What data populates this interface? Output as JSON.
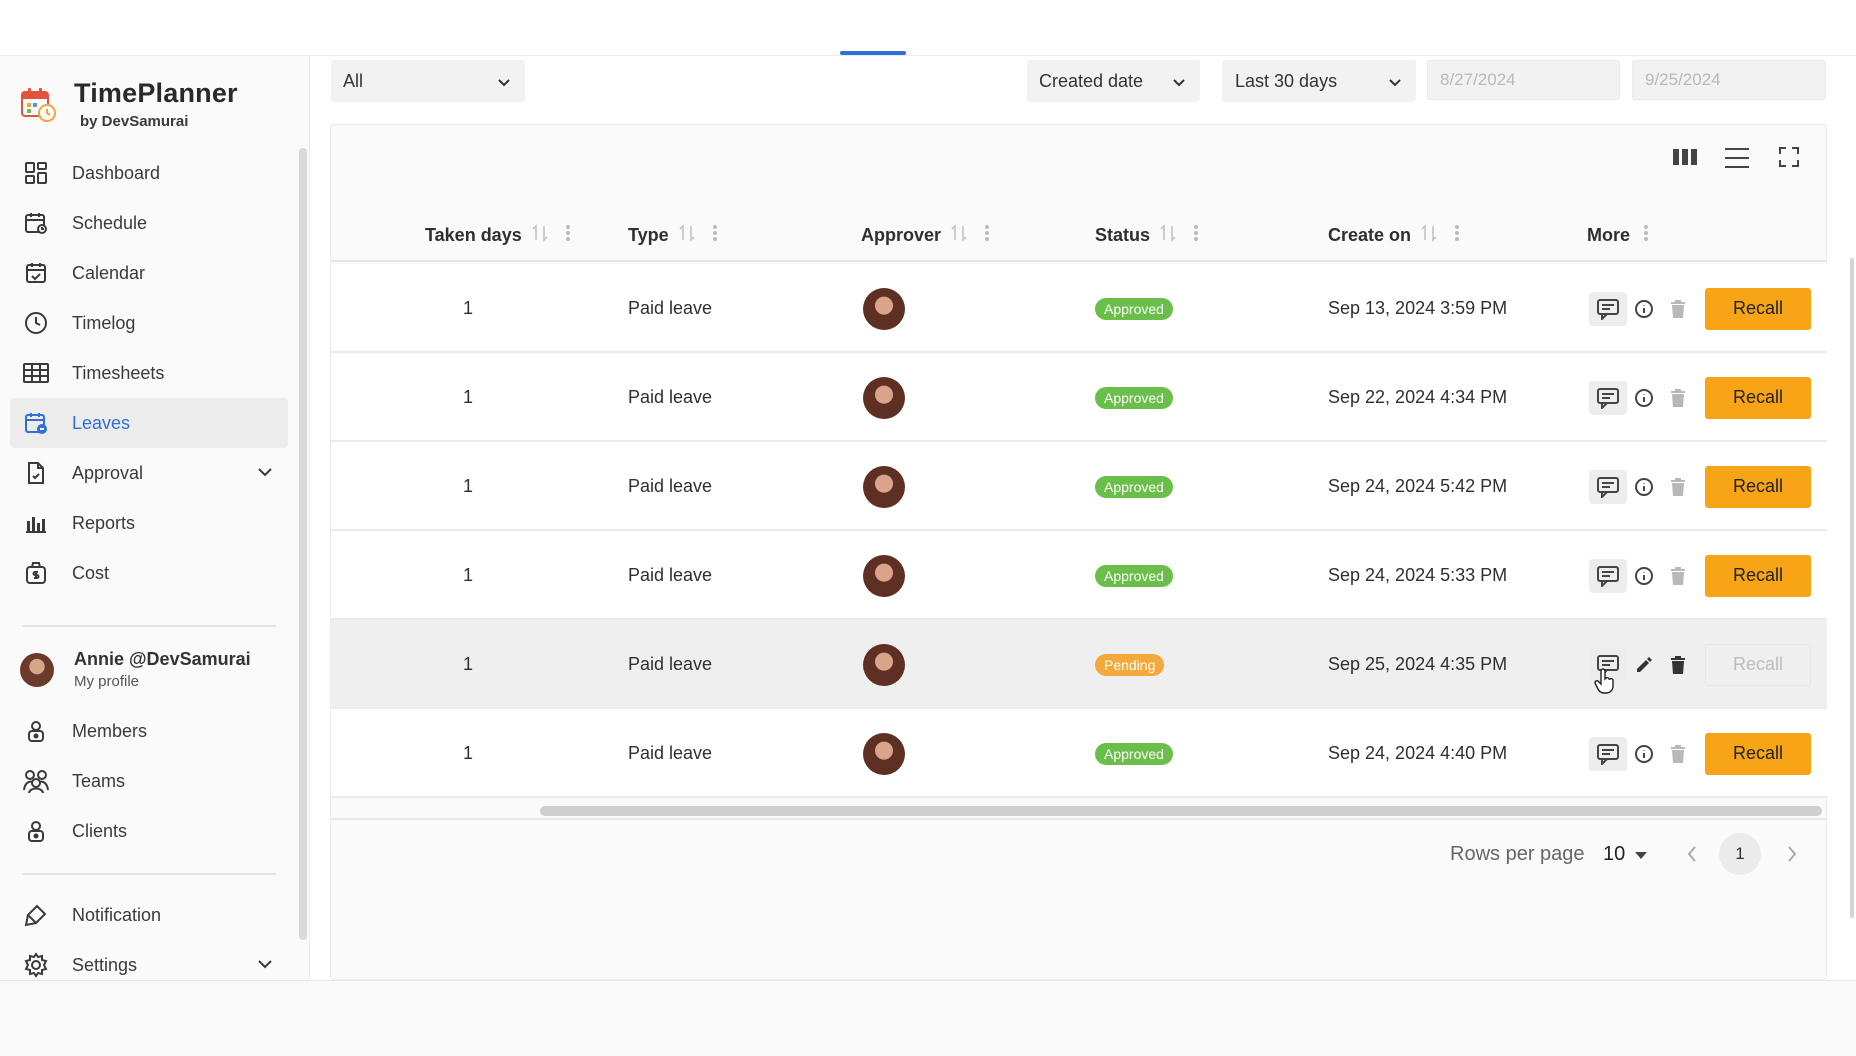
{
  "brand": {
    "name": "TimePlanner",
    "by": "by DevSamurai"
  },
  "sidebar": {
    "items": [
      {
        "label": "Dashboard",
        "icon": "dashboard-icon"
      },
      {
        "label": "Schedule",
        "icon": "schedule-icon"
      },
      {
        "label": "Calendar",
        "icon": "calendar-icon"
      },
      {
        "label": "Timelog",
        "icon": "clock-icon"
      },
      {
        "label": "Timesheets",
        "icon": "table-icon"
      },
      {
        "label": "Leaves",
        "icon": "leaves-icon",
        "active": true
      },
      {
        "label": "Approval",
        "icon": "approval-icon",
        "expandable": true
      },
      {
        "label": "Reports",
        "icon": "bar-chart-icon"
      },
      {
        "label": "Cost",
        "icon": "cost-icon"
      }
    ],
    "profile": {
      "name": "Annie @DevSamurai",
      "sub": "My profile"
    },
    "team_items": [
      {
        "label": "Members",
        "icon": "lock-icon"
      },
      {
        "label": "Teams",
        "icon": "teams-icon"
      },
      {
        "label": "Clients",
        "icon": "lock-icon"
      }
    ],
    "bottom_items": [
      {
        "label": "Notification",
        "icon": "notification-icon"
      },
      {
        "label": "Settings",
        "icon": "gear-icon",
        "expandable": true
      }
    ]
  },
  "filters": {
    "type": "All",
    "sort_by": "Created date",
    "range": "Last 30 days",
    "start_date_placeholder": "8/27/2024",
    "end_date_placeholder": "9/25/2024"
  },
  "table": {
    "columns": [
      "Taken days",
      "Type",
      "Approver",
      "Status",
      "Create on",
      "More"
    ],
    "rows": [
      {
        "taken": "1",
        "type": "Paid leave",
        "status": "Approved",
        "created": "Sep 13, 2024 3:59 PM",
        "recall": "Recall"
      },
      {
        "taken": "1",
        "type": "Paid leave",
        "status": "Approved",
        "created": "Sep 22, 2024 4:34 PM",
        "recall": "Recall"
      },
      {
        "taken": "1",
        "type": "Paid leave",
        "status": "Approved",
        "created": "Sep 24, 2024 5:42 PM",
        "recall": "Recall"
      },
      {
        "taken": "1",
        "type": "Paid leave",
        "status": "Approved",
        "created": "Sep 24, 2024 5:33 PM",
        "recall": "Recall"
      },
      {
        "taken": "1",
        "type": "Paid leave",
        "status": "Pending",
        "created": "Sep 25, 2024 4:35 PM",
        "recall": "Recall"
      },
      {
        "taken": "1",
        "type": "Paid leave",
        "status": "Approved",
        "created": "Sep 24, 2024 4:40 PM",
        "recall": "Recall"
      }
    ]
  },
  "pagination": {
    "rows_per_page_label": "Rows per page",
    "rows_per_page": "10",
    "current_page": "1"
  },
  "colors": {
    "accent": "#2f6fd8",
    "recall": "#f7a416",
    "approved": "#6abf4b",
    "pending": "#f3a93b"
  }
}
